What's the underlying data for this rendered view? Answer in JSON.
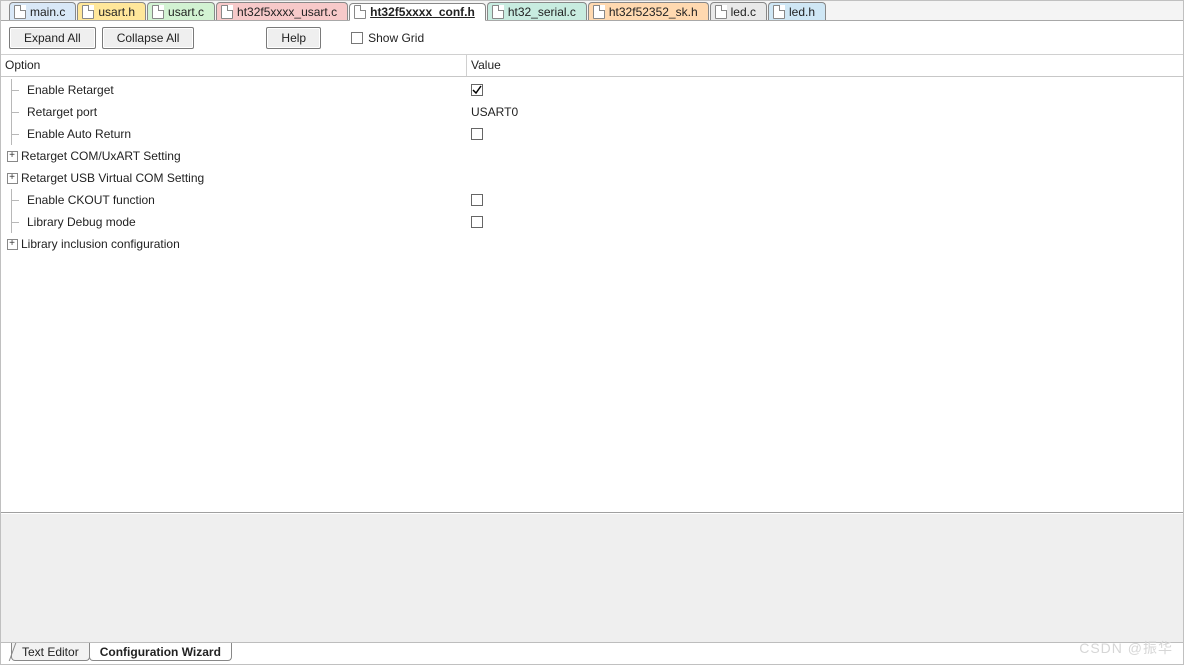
{
  "tabs": [
    {
      "label": "main.c",
      "color": "#d9e8f7",
      "active": false
    },
    {
      "label": "usart.h",
      "color": "#ffe79a",
      "active": false
    },
    {
      "label": "usart.c",
      "color": "#d2f2d2",
      "active": false
    },
    {
      "label": "ht32f5xxxx_usart.c",
      "color": "#f7c9c9",
      "active": false
    },
    {
      "label": "ht32f5xxxx_conf.h",
      "color": "#d9cff0",
      "active": true
    },
    {
      "label": "ht32_serial.c",
      "color": "#c8ece0",
      "active": false
    },
    {
      "label": "ht32f52352_sk.h",
      "color": "#ffd9b0",
      "active": false
    },
    {
      "label": "led.c",
      "color": "#e9e9e9",
      "active": false
    },
    {
      "label": "led.h",
      "color": "#cfe7f5",
      "active": false
    }
  ],
  "toolbar": {
    "expand_all": "Expand All",
    "collapse_all": "Collapse All",
    "help": "Help",
    "show_grid_label": "Show Grid",
    "show_grid_checked": false
  },
  "columns": {
    "option": "Option",
    "value": "Value"
  },
  "options": [
    {
      "label": "Enable Retarget",
      "kind": "bool",
      "checked": true,
      "expandable": false,
      "indent": 1
    },
    {
      "label": "Retarget port",
      "kind": "text",
      "value": "USART0",
      "expandable": false,
      "indent": 1
    },
    {
      "label": "Enable Auto Return",
      "kind": "bool",
      "checked": false,
      "expandable": false,
      "indent": 1
    },
    {
      "label": "Retarget COM/UxART Setting",
      "kind": "group",
      "expandable": true,
      "indent": 0
    },
    {
      "label": "Retarget USB Virtual COM Setting",
      "kind": "group",
      "expandable": true,
      "indent": 0
    },
    {
      "label": "Enable CKOUT function",
      "kind": "bool",
      "checked": false,
      "expandable": false,
      "indent": 1
    },
    {
      "label": "Library Debug mode",
      "kind": "bool",
      "checked": false,
      "expandable": false,
      "indent": 1
    },
    {
      "label": "Library inclusion configuration",
      "kind": "group",
      "expandable": true,
      "indent": 0
    }
  ],
  "bottom_tabs": {
    "text_editor": "Text Editor",
    "config_wizard": "Configuration Wizard",
    "active": "config_wizard"
  },
  "watermark": "CSDN @振华"
}
